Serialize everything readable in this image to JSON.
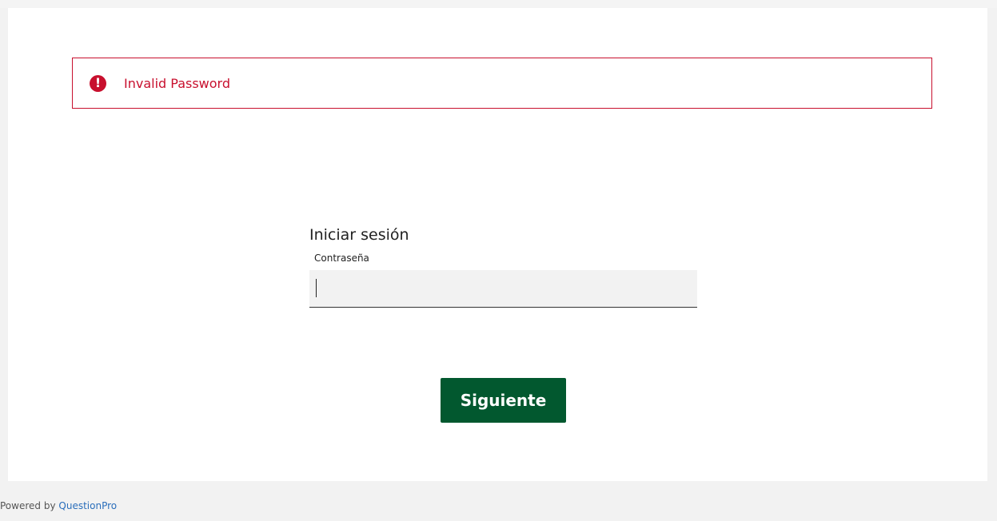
{
  "alert": {
    "message": "Invalid Password",
    "icon": "exclamation-circle-icon",
    "color": "#c8102e"
  },
  "login": {
    "title": "Iniciar sesión",
    "password_label": "Contraseña",
    "password_value": "",
    "next_button": "Siguiente",
    "button_color": "#02582f"
  },
  "footer": {
    "powered_by": "Powered by",
    "brand": "QuestionPro",
    "link_color": "#2a6ebb"
  }
}
